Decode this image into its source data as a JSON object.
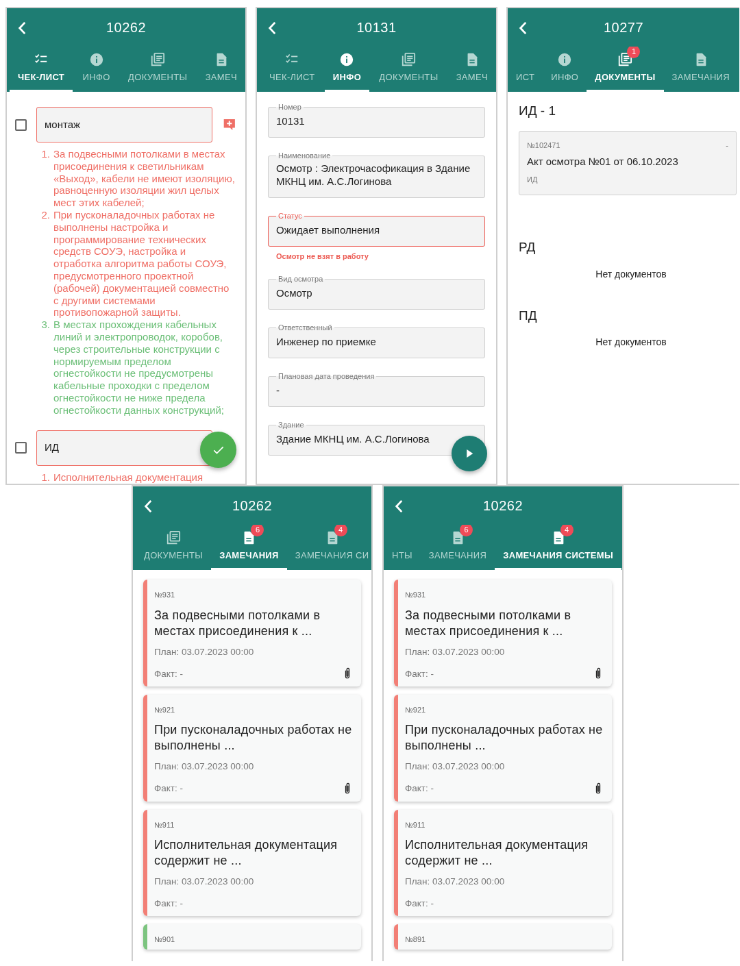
{
  "screens": [
    {
      "kind": "checklist",
      "title": "10262",
      "fab": {
        "kind": "check"
      },
      "tabs": [
        {
          "label": "ЧЕК-ЛИСТ",
          "kind": "checklist",
          "selected": true
        },
        {
          "label": "ИНФО",
          "kind": "info",
          "selected": false
        },
        {
          "label": "ДОКУМЕНТЫ",
          "kind": "documents",
          "selected": false
        },
        {
          "label": "ЗАМЕЧ",
          "kind": "remarks",
          "selected": false
        }
      ],
      "items": [
        {
          "label": "монтаж",
          "checked": false,
          "remarks": [
            {
              "number": "1.",
              "text": "За подвесными потолками в местах присоединения к светильникам «Выход», кабели не имеют изоляцию, равноценную изоляции жил целых мест этих кабелей;",
              "color": "#ef6f66"
            },
            {
              "number": "2.",
              "text": "При пусконаладочных работах не выполнены настройка и программирование технических средств СОУЭ, настройка и отработка алгоритма работы СОУЭ, предусмотренного проектной (рабочей) документацией совместно с другими системами противопожарной защиты.",
              "color": "#ef6f66"
            },
            {
              "number": "3.",
              "text": "В местах прохождения кабельных линий и электропроводок, коробов, через строительные конструкции с нормируемым пределом огнестойкости не предусмотрены кабельные проходки с пределом огнестойкости не ниже предела огнестойкости данных конструкций;",
              "color": "#6cbf78"
            }
          ]
        },
        {
          "label": "ИД",
          "checked": false,
          "remarks": [
            {
              "number": "1.",
              "text": "Исполнительная документация",
              "color": "#ef6f66"
            }
          ]
        }
      ]
    },
    {
      "kind": "info",
      "title": "10131",
      "fab": {
        "kind": "play"
      },
      "tabs": [
        {
          "label": "ЧЕК-ЛИСТ",
          "kind": "checklist",
          "selected": false
        },
        {
          "label": "ИНФО",
          "kind": "info",
          "selected": true
        },
        {
          "label": "ДОКУМЕНТЫ",
          "kind": "documents",
          "selected": false
        },
        {
          "label": "ЗАМЕЧ",
          "kind": "remarks",
          "selected": false
        }
      ],
      "fields": [
        {
          "label": "Номер",
          "value": "10131",
          "error": false
        },
        {
          "label": "Наименование",
          "value": "Осмотр : Электрочасофикация в Здание МКНЦ им. А.С.Логинова",
          "error": false
        },
        {
          "label": "Статус",
          "value": "Ожидает выполнения",
          "error": true,
          "helper": "Осмотр не взят в работу"
        },
        {
          "label": "Вид осмотра",
          "value": "Осмотр",
          "error": false
        },
        {
          "label": "Ответственный",
          "value": "Инженер по приемке",
          "error": false
        },
        {
          "label": "Плановая дата проведения",
          "value": "-",
          "error": false
        },
        {
          "label": "Здание",
          "value": "Здание МКНЦ им. А.С.Логинова",
          "error": false
        }
      ]
    },
    {
      "kind": "documents",
      "title": "10277",
      "tabs": [
        {
          "label": "ИСТ",
          "selected": false
        },
        {
          "label": "ИНФО",
          "kind": "info",
          "selected": false
        },
        {
          "label": "ДОКУМЕНТЫ",
          "kind": "documents",
          "selected": true,
          "badge": "1"
        },
        {
          "label": "ЗАМЕЧАНИЯ",
          "kind": "remarks",
          "selected": false
        }
      ],
      "sections": [
        {
          "title": "ИД - 1",
          "documents": [
            {
              "number": "№102471",
              "corner": "-",
              "title": "Акт осмотра №01 от 06.10.2023",
              "type": "ИД"
            }
          ]
        },
        {
          "title": "РД",
          "empty": "Нет документов"
        },
        {
          "title": "ПД",
          "empty": "Нет документов"
        }
      ]
    },
    {
      "kind": "remarks",
      "title": "10262",
      "tabs": [
        {
          "label": "ДОКУМЕНТЫ",
          "kind": "documents",
          "selected": false
        },
        {
          "label": "ЗАМЕЧАНИЯ",
          "kind": "remarks",
          "selected": true,
          "badge": "6"
        },
        {
          "label": "ЗАМЕЧАНИЯ СИ",
          "kind": "remarks",
          "selected": false,
          "badge": "4"
        }
      ],
      "cards": [
        {
          "number": "№931",
          "title": "За подвесными потолками в местах присоединения к ...",
          "plan": "План: 03.07.2023 00:00",
          "fact": "Факт: -",
          "attachment": true,
          "color": "#f27f76"
        },
        {
          "number": "№921",
          "title": "При пусконаладочных работах не выполнены ...",
          "plan": "План: 03.07.2023 00:00",
          "fact": "Факт: -",
          "attachment": true,
          "color": "#f27f76"
        },
        {
          "number": "№911",
          "title": "Исполнительная документация содержит не ...",
          "plan": "План: 03.07.2023 00:00",
          "fact": "Факт: -",
          "attachment": false,
          "color": "#f27f76"
        },
        {
          "number": "№901",
          "color": "#7cc47f",
          "attachment": false
        }
      ]
    },
    {
      "kind": "remarks",
      "title": "10262",
      "tabs": [
        {
          "label": "НТЫ",
          "selected": false
        },
        {
          "label": "ЗАМЕЧАНИЯ",
          "kind": "remarks",
          "selected": false,
          "badge": "6"
        },
        {
          "label": "ЗАМЕЧАНИЯ СИСТЕМЫ",
          "kind": "remarks",
          "selected": true,
          "badge": "4"
        }
      ],
      "cards": [
        {
          "number": "№931",
          "title": "За подвесными потолками в местах присоединения к ...",
          "plan": "План: 03.07.2023 00:00",
          "fact": "Факт: -",
          "attachment": true,
          "color": "#f27f76"
        },
        {
          "number": "№921",
          "title": "При пусконаладочных работах не выполнены ...",
          "plan": "План: 03.07.2023 00:00",
          "fact": "Факт: -",
          "attachment": true,
          "color": "#f27f76"
        },
        {
          "number": "№911",
          "title": "Исполнительная документация содержит не ...",
          "plan": "План: 03.07.2023 00:00",
          "fact": "Факт: -",
          "attachment": false,
          "color": "#f27f76"
        },
        {
          "number": "№891",
          "color": "#f27f76",
          "attachment": false
        }
      ]
    }
  ]
}
